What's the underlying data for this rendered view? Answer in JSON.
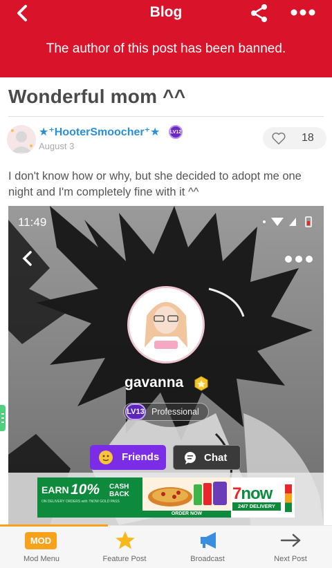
{
  "header": {
    "title": "Blog",
    "banner": "The author of this post has been banned.",
    "back_icon": "chevron-left-icon",
    "share_icon": "share-icon",
    "more_icon": "more-dots-icon",
    "background_color": "#d8132a"
  },
  "post": {
    "title": "Wonderful mom ^^",
    "author": {
      "name": "★⁺HooterSmoocher⁺★",
      "level_badge": "LV12",
      "date": "August 3"
    },
    "likes": "18",
    "body": "I don't know how or why, but she decided to adopt me one night and I'm completely fine with it ^^"
  },
  "embedded_screenshot": {
    "time": "11:49",
    "username": "gavanna",
    "level": "LV13",
    "level_title": "Professional",
    "friends_label": "Friends",
    "chat_label": "Chat"
  },
  "ad": {
    "earn": "EARN",
    "percent": "10%",
    "cash_back": "CASH\nBACK",
    "fine_print": "ON DELIVERY ORDERS with 7NOW GOLD PASS",
    "order_now": "ORDER NOW",
    "brand_number": "7",
    "brand_word": "now",
    "delivery": "24/7 DELIVERY"
  },
  "bottom_nav": {
    "items": [
      {
        "label": "Mod Menu",
        "icon": "MOD"
      },
      {
        "label": "Feature Post",
        "icon": "star-icon"
      },
      {
        "label": "Broadcast",
        "icon": "megaphone-icon"
      },
      {
        "label": "Next Post",
        "icon": "arrow-right-icon"
      }
    ],
    "accent_color": "#f6a21b"
  }
}
